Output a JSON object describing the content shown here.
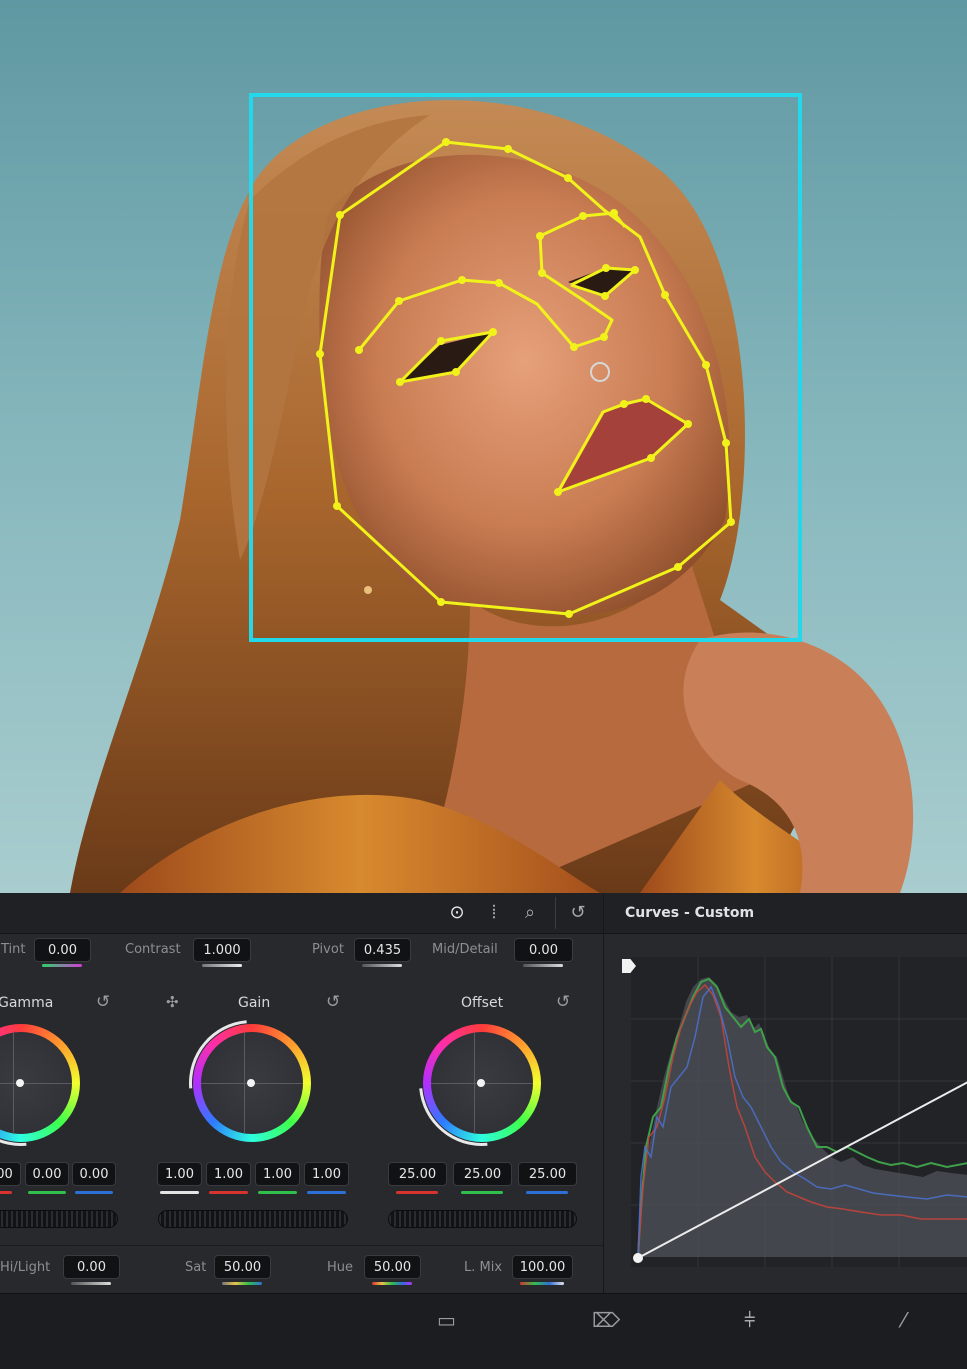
{
  "primaries": {
    "top_row": {
      "tint": {
        "label": "Tint",
        "value": "0.00"
      },
      "contrast": {
        "label": "Contrast",
        "value": "1.000"
      },
      "pivot": {
        "label": "Pivot",
        "value": "0.435"
      },
      "mid_detail": {
        "label": "Mid/Detail",
        "value": "0.00"
      }
    },
    "wheels": {
      "gamma": {
        "title": "Gamma",
        "values": [
          "00",
          "0.00",
          "0.00"
        ]
      },
      "gain": {
        "title": "Gain",
        "values": [
          "1.00",
          "1.00",
          "1.00",
          "1.00"
        ]
      },
      "offset": {
        "title": "Offset",
        "values": [
          "25.00",
          "25.00",
          "25.00"
        ]
      }
    },
    "bottom_row": {
      "hi_light": {
        "label": "Hi/Light",
        "value": "0.00"
      },
      "sat": {
        "label": "Sat",
        "value": "50.00"
      },
      "hue": {
        "label": "Hue",
        "value": "50.00"
      },
      "l_mix": {
        "label": "L. Mix",
        "value": "100.00"
      }
    },
    "toolbar_icons": [
      "wheels-icon",
      "bars-icon",
      "log-icon",
      "reset-all-icon"
    ]
  },
  "curves": {
    "title": "Curves - Custom"
  },
  "bottom_bar": {
    "icons": [
      "media-icon",
      "fusion-icon",
      "color-icon",
      "edit-icon"
    ]
  },
  "viewer": {
    "overlay_colors": {
      "face_box": "#23d8ea",
      "landmarks": "#f1f21a"
    }
  }
}
